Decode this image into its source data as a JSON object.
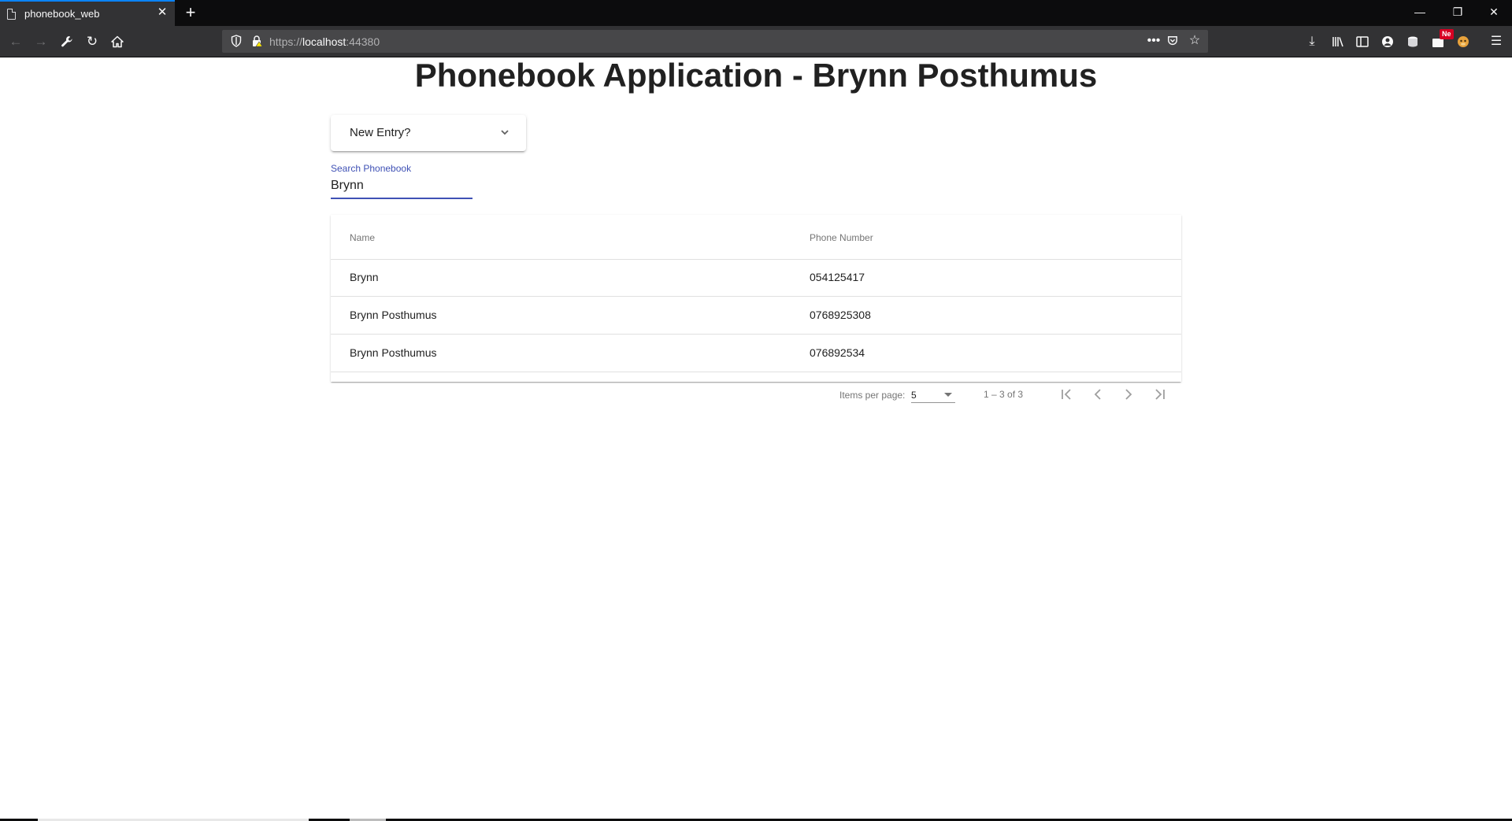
{
  "browser": {
    "tab_title": "phonebook_web",
    "url_scheme_prefix": "https://",
    "url_host": "localhost",
    "url_port": ":44380",
    "notification_badge": "Ne",
    "accent_color": "#0a84ff"
  },
  "page": {
    "title": "Phonebook Application - Brynn Posthumus"
  },
  "new_entry": {
    "label": "New Entry?"
  },
  "search": {
    "label": "Search Phonebook",
    "value": "Brynn"
  },
  "table": {
    "headers": {
      "name": "Name",
      "phone": "Phone Number"
    },
    "rows": [
      {
        "name": "Brynn",
        "phone": "054125417"
      },
      {
        "name": "Brynn Posthumus",
        "phone": "0768925308"
      },
      {
        "name": "Brynn Posthumus",
        "phone": "076892534"
      }
    ]
  },
  "paginator": {
    "items_per_page_label": "Items per page:",
    "page_size": "5",
    "range": "1 – 3 of 3"
  },
  "colors": {
    "primary": "#3f51b5",
    "title_text": "#212121"
  }
}
